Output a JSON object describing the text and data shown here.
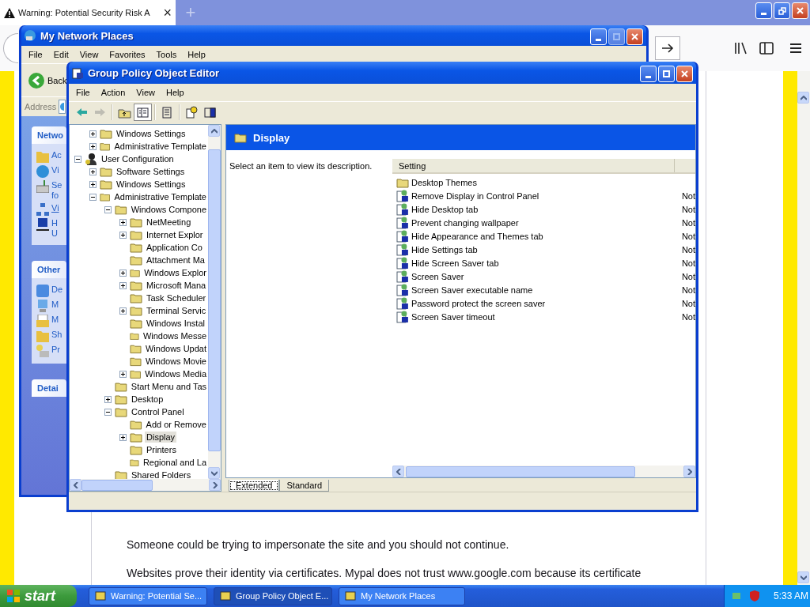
{
  "browser": {
    "tab": {
      "title": "Warning: Potential Security Risk A",
      "close": "×"
    },
    "new_tab": "+",
    "page": {
      "paragraphs": [
        "Someone could be trying to impersonate the site and you should not continue.",
        "Websites prove their identity via certificates. Mypal does not trust www.google.com because its certificate"
      ]
    }
  },
  "network_window": {
    "title": "My Network Places",
    "maximize_disabled": true,
    "menu": [
      "File",
      "Edit",
      "View",
      "Favorites",
      "Tools",
      "Help"
    ],
    "back": "Back",
    "address_label": "Address",
    "task_groups": [
      {
        "title": "Netwo",
        "items": [
          {
            "kind": "task",
            "lines": [
              "Ac"
            ]
          },
          {
            "kind": "task",
            "lines": [
              "Vi"
            ]
          },
          {
            "kind": "task",
            "lines": [
              "Se",
              "fo"
            ]
          },
          {
            "kind": "link",
            "lines": [
              "Vi"
            ]
          },
          {
            "kind": "task",
            "lines": [
              "H",
              "U"
            ]
          }
        ]
      },
      {
        "title": "Other",
        "items": [
          {
            "kind": "task",
            "lines": [
              "De"
            ]
          },
          {
            "kind": "task",
            "lines": [
              "M"
            ]
          },
          {
            "kind": "task",
            "lines": [
              "M"
            ]
          },
          {
            "kind": "task",
            "lines": [
              "Sh"
            ]
          },
          {
            "kind": "task",
            "lines": [
              "Pr"
            ]
          }
        ]
      },
      {
        "title": "Detai"
      }
    ]
  },
  "gpo_window": {
    "title": "Group Policy Object Editor",
    "menu": [
      "File",
      "Action",
      "View",
      "Help"
    ],
    "toolbar": [
      {
        "disabled": false,
        "pressed": false
      },
      {
        "disabled": true,
        "pressed": false
      },
      {
        "disabled": false,
        "pressed": false
      },
      {
        "disabled": false,
        "pressed": true
      },
      {
        "disabled": false,
        "pressed": false
      },
      {
        "disabled": false,
        "pressed": false
      },
      {
        "disabled": false,
        "pressed": false
      }
    ],
    "tree": {
      "scrolled_parent_children": [
        {
          "label": "Windows Settings",
          "kind": "folder",
          "selected": false,
          "expanded": false
        },
        {
          "label": "Administrative Template",
          "kind": "folder",
          "selected": false,
          "expanded": false
        }
      ],
      "items": [
        {
          "label": "User Configuration",
          "kind": "user",
          "selected": false,
          "expanded": true,
          "children": [
            {
              "label": "Software Settings",
              "kind": "folder",
              "selected": false,
              "expanded": false
            },
            {
              "label": "Windows Settings",
              "kind": "folder",
              "selected": false,
              "expanded": false
            },
            {
              "label": "Administrative Template",
              "kind": "folder",
              "selected": false,
              "expanded": true,
              "children": [
                {
                  "label": "Windows Compone",
                  "kind": "folder",
                  "selected": false,
                  "expanded": true,
                  "children": [
                    {
                      "label": "NetMeeting",
                      "kind": "folder",
                      "selected": false,
                      "expanded": false
                    },
                    {
                      "label": "Internet Explor",
                      "kind": "folder",
                      "selected": false,
                      "expanded": false
                    },
                    {
                      "label": "Application Co",
                      "kind": "folder",
                      "selected": false
                    },
                    {
                      "label": "Attachment Ma",
                      "kind": "folder",
                      "selected": false
                    },
                    {
                      "label": "Windows Explor",
                      "kind": "folder",
                      "selected": false,
                      "expanded": false
                    },
                    {
                      "label": "Microsoft Mana",
                      "kind": "folder",
                      "selected": false,
                      "expanded": false
                    },
                    {
                      "label": "Task Scheduler",
                      "kind": "folder",
                      "selected": false
                    },
                    {
                      "label": "Terminal Servic",
                      "kind": "folder",
                      "selected": false,
                      "expanded": false
                    },
                    {
                      "label": "Windows Instal",
                      "kind": "folder",
                      "selected": false
                    },
                    {
                      "label": "Windows Messe",
                      "kind": "folder",
                      "selected": false
                    },
                    {
                      "label": "Windows Updat",
                      "kind": "folder",
                      "selected": false
                    },
                    {
                      "label": "Windows Movie",
                      "kind": "folder",
                      "selected": false
                    },
                    {
                      "label": "Windows Media",
                      "kind": "folder",
                      "selected": false,
                      "expanded": false
                    }
                  ]
                },
                {
                  "label": "Start Menu and Tas",
                  "kind": "folder",
                  "selected": false
                },
                {
                  "label": "Desktop",
                  "kind": "folder",
                  "selected": false,
                  "expanded": false
                },
                {
                  "label": "Control Panel",
                  "kind": "folder",
                  "selected": false,
                  "expanded": true,
                  "children": [
                    {
                      "label": "Add or Remove",
                      "kind": "folder",
                      "selected": false
                    },
                    {
                      "label": "Display",
                      "kind": "folder",
                      "selected": true,
                      "expanded": false
                    },
                    {
                      "label": "Printers",
                      "kind": "folder",
                      "selected": false
                    },
                    {
                      "label": "Regional and La",
                      "kind": "folder",
                      "selected": false
                    }
                  ]
                },
                {
                  "label": "Shared Folders",
                  "kind": "folder",
                  "selected": false
                }
              ]
            }
          ]
        }
      ]
    },
    "detail": {
      "heading": "Display",
      "description": "Select an item to view its description.",
      "columns": [
        "Setting"
      ],
      "rows": [
        {
          "kind": "folder",
          "name": "Desktop Themes"
        },
        {
          "kind": "policy",
          "name": "Remove Display in Control Panel",
          "state": "Not"
        },
        {
          "kind": "policy",
          "name": "Hide Desktop tab",
          "state": "Not"
        },
        {
          "kind": "policy",
          "name": "Prevent changing wallpaper",
          "state": "Not"
        },
        {
          "kind": "policy",
          "name": "Hide Appearance and Themes tab",
          "state": "Not"
        },
        {
          "kind": "policy",
          "name": "Hide Settings tab",
          "state": "Not"
        },
        {
          "kind": "policy",
          "name": "Hide Screen Saver tab",
          "state": "Not"
        },
        {
          "kind": "policy",
          "name": "Screen Saver",
          "state": "Not"
        },
        {
          "kind": "policy",
          "name": "Screen Saver executable name",
          "state": "Not"
        },
        {
          "kind": "policy",
          "name": "Password protect the screen saver",
          "state": "Not"
        },
        {
          "kind": "policy",
          "name": "Screen Saver timeout",
          "state": "Not"
        }
      ]
    },
    "tabs": [
      {
        "label": "Extended",
        "selected": true
      },
      {
        "label": "Standard",
        "selected": false
      }
    ]
  },
  "taskbar": {
    "start": "start",
    "buttons": [
      {
        "label": "Warning: Potential Se...",
        "selected": false
      },
      {
        "label": "Group Policy Object E...",
        "selected": true
      },
      {
        "label": "My Network Places",
        "selected": false
      }
    ],
    "clock": "5:33 AM"
  }
}
